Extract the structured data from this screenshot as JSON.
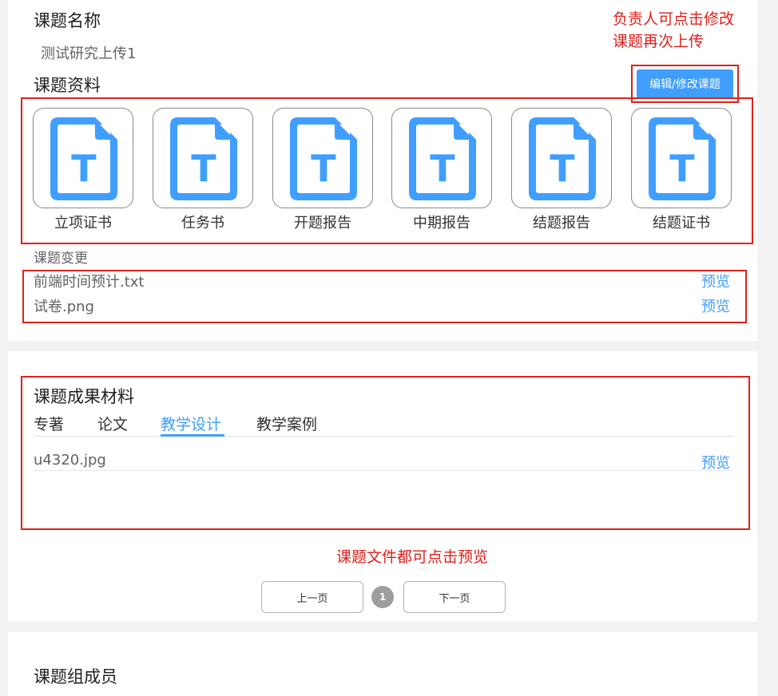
{
  "project": {
    "name_heading": "课题名称",
    "name_value": "测试研究上传1"
  },
  "materials": {
    "heading": "课题资料",
    "edit_button": "编辑/修改课题",
    "tiles": [
      {
        "label": "立项证书",
        "icon": "text-file-icon"
      },
      {
        "label": "任务书",
        "icon": "text-file-icon"
      },
      {
        "label": "开题报告",
        "icon": "text-file-icon"
      },
      {
        "label": "中期报告",
        "icon": "text-file-icon"
      },
      {
        "label": "结题报告",
        "icon": "text-file-icon"
      },
      {
        "label": "结题证书",
        "icon": "text-file-icon"
      }
    ],
    "icon_letter": "T",
    "change_heading": "课题变更",
    "change_files": [
      {
        "name": "前端时间预计.txt",
        "action": "预览"
      },
      {
        "name": "试卷.png",
        "action": "预览"
      }
    ]
  },
  "results": {
    "heading": "课题成果材料",
    "tabs": [
      "专著",
      "论文",
      "教学设计",
      "教学案例"
    ],
    "active_tab": "教学设计",
    "files": [
      {
        "name": "u4320.jpg",
        "action": "预览"
      }
    ]
  },
  "pagination": {
    "prev": "上一页",
    "current": "1",
    "next": "下一页"
  },
  "members": {
    "heading": "课题组成员"
  },
  "annotations": {
    "edit_note_line1": "负责人可点击修改",
    "edit_note_line2": "课题再次上传",
    "preview_note": "课题文件都可点击预览"
  },
  "colors": {
    "accent": "#409eff",
    "annotation": "#e0201b"
  }
}
